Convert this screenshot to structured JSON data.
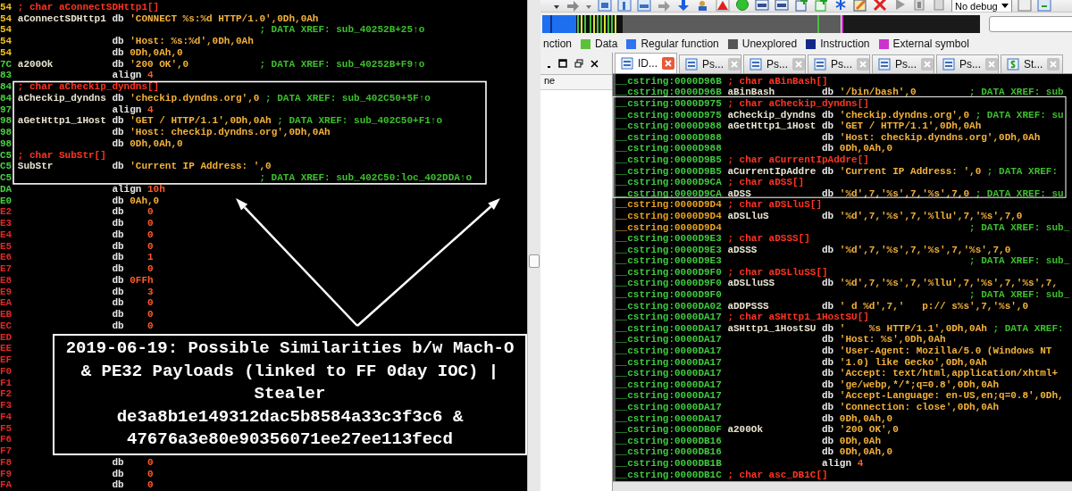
{
  "left_listing": {
    "rows": [
      {
        "addr": "54",
        "color": "#f0c020",
        "kind": "decl",
        "text": "; char aConnectSDHttp1[]"
      },
      {
        "addr": "54",
        "color": "#f0c020",
        "kind": "code",
        "label": "aConnectSDHttp1",
        "mnemonic": "db",
        "operand": "'CONNECT %s:%d HTTP/1.0',0Dh,0Ah"
      },
      {
        "addr": "54",
        "color": "#f0c020",
        "kind": "code",
        "comment": "; DATA XREF: sub_40252B+25↑o"
      },
      {
        "addr": "54",
        "color": "#f0c020",
        "kind": "code",
        "mnemonic": "db",
        "operand": "'Host: %s:%d',0Dh,0Ah"
      },
      {
        "addr": "54",
        "color": "#f0c020",
        "kind": "code",
        "mnemonic": "db",
        "operand": "0Dh,0Ah,0"
      },
      {
        "addr": "7C",
        "color": "#48d040",
        "kind": "code",
        "label": "a200Ok",
        "mnemonic": "db",
        "operand": "'200 OK',0",
        "comment": "; DATA XREF: sub_40252B+F9↑o"
      },
      {
        "addr": "83",
        "color": "#48d040",
        "kind": "align",
        "mnemonic": "align",
        "operand": "4"
      },
      {
        "addr": "84",
        "color": "#48d040",
        "kind": "decl",
        "text": "; char aCheckip_dyndns[]"
      },
      {
        "addr": "84",
        "color": "#48d040",
        "kind": "code",
        "label": "aCheckip_dyndns",
        "mnemonic": "db",
        "operand": "'checkip.dyndns.org',0",
        "comment": "; DATA XREF: sub_402C50+5F↑o"
      },
      {
        "addr": "97",
        "color": "#48d040",
        "kind": "align",
        "mnemonic": "align",
        "operand": "4"
      },
      {
        "addr": "98",
        "color": "#48d040",
        "kind": "code",
        "label": "aGetHttp1_1Host",
        "mnemonic": "db",
        "operand": "'GET / HTTP/1.1',0Dh,0Ah",
        "comment": "; DATA XREF: sub_402C50+F1↑o"
      },
      {
        "addr": "98",
        "color": "#48d040",
        "kind": "code",
        "mnemonic": "db",
        "operand": "'Host: checkip.dyndns.org',0Dh,0Ah"
      },
      {
        "addr": "98",
        "color": "#48d040",
        "kind": "code",
        "mnemonic": "db",
        "operand": "0Dh,0Ah,0"
      },
      {
        "addr": "C5",
        "color": "#48d040",
        "kind": "decl",
        "text": "; char SubStr[]"
      },
      {
        "addr": "C5",
        "color": "#48d040",
        "kind": "code",
        "label": "SubStr",
        "mnemonic": "db",
        "operand": "'Current IP Address: ',0"
      },
      {
        "addr": "C5",
        "color": "#48d040",
        "kind": "code",
        "comment": "; DATA XREF: sub_402C50:loc_402DDA↑o"
      },
      {
        "addr": "DA",
        "color": "#48d040",
        "kind": "align",
        "mnemonic": "align",
        "operand": "10h"
      },
      {
        "addr": "E0",
        "color": "#48d040",
        "kind": "code",
        "mnemonic": "db",
        "operand": "0Ah,0"
      },
      {
        "addr": "E2",
        "color": "#e02828",
        "kind": "byte",
        "mnemonic": "db",
        "operand": "0"
      },
      {
        "addr": "E3",
        "color": "#e02828",
        "kind": "byte",
        "mnemonic": "db",
        "operand": "0"
      },
      {
        "addr": "E4",
        "color": "#e02828",
        "kind": "byte",
        "mnemonic": "db",
        "operand": "0"
      },
      {
        "addr": "E5",
        "color": "#e02828",
        "kind": "byte",
        "mnemonic": "db",
        "operand": "0"
      },
      {
        "addr": "E6",
        "color": "#e02828",
        "kind": "byte",
        "mnemonic": "db",
        "operand": "1"
      },
      {
        "addr": "E7",
        "color": "#e02828",
        "kind": "byte",
        "mnemonic": "db",
        "operand": "0"
      },
      {
        "addr": "E8",
        "color": "#e02828",
        "kind": "byte",
        "mnemonic": "db",
        "operand": "0FFh"
      },
      {
        "addr": "E9",
        "color": "#e02828",
        "kind": "byte",
        "mnemonic": "db",
        "operand": "3"
      },
      {
        "addr": "EA",
        "color": "#e02828",
        "kind": "byte",
        "mnemonic": "db",
        "operand": "0"
      },
      {
        "addr": "EB",
        "color": "#e02828",
        "kind": "byte",
        "mnemonic": "db",
        "operand": "0"
      },
      {
        "addr": "EC",
        "color": "#e02828",
        "kind": "byte",
        "mnemonic": "db",
        "operand": "0"
      },
      {
        "addr": "ED",
        "color": "#e02828",
        "kind": "code"
      },
      {
        "addr": "EE",
        "color": "#e02828",
        "kind": "code"
      },
      {
        "addr": "EF",
        "color": "#e02828",
        "kind": "code"
      },
      {
        "addr": "F0",
        "color": "#e02828",
        "kind": "code"
      },
      {
        "addr": "F1",
        "color": "#e02828",
        "kind": "code"
      },
      {
        "addr": "F2",
        "color": "#e02828",
        "kind": "code"
      },
      {
        "addr": "F3",
        "color": "#e02828",
        "kind": "code"
      },
      {
        "addr": "F4",
        "color": "#e02828",
        "kind": "code"
      },
      {
        "addr": "F5",
        "color": "#e02828",
        "kind": "code"
      },
      {
        "addr": "F6",
        "color": "#e02828",
        "kind": "code"
      },
      {
        "addr": "F7",
        "color": "#e02828",
        "kind": "code"
      },
      {
        "addr": "F8",
        "color": "#e02828",
        "kind": "byte",
        "mnemonic": "db",
        "operand": "0"
      },
      {
        "addr": "F9",
        "color": "#e02828",
        "kind": "byte",
        "mnemonic": "db",
        "operand": "0"
      },
      {
        "addr": "FA",
        "color": "#e02828",
        "kind": "byte",
        "mnemonic": "db",
        "operand": "0"
      }
    ]
  },
  "ida_window": {
    "toolbar": {
      "debugger_select": "No debug"
    },
    "legend": [
      {
        "label": "nction"
      },
      {
        "label": "Data",
        "color": "#5cc23e"
      },
      {
        "label": "Regular function",
        "color": "#2f74f0"
      },
      {
        "label": "Unexplored",
        "color": "#555555"
      },
      {
        "label": "Instruction",
        "color": "#13288a"
      },
      {
        "label": "External symbol",
        "color": "#cc33cc"
      }
    ],
    "functions_pane": {
      "column_header": "ne"
    },
    "tabs": [
      {
        "label": "ID...",
        "kind": "listing",
        "selected": true
      },
      {
        "label": "Ps...",
        "kind": "listing",
        "selected": false
      },
      {
        "label": "Ps...",
        "kind": "listing",
        "selected": false
      },
      {
        "label": "Ps...",
        "kind": "listing",
        "selected": false
      },
      {
        "label": "Ps...",
        "kind": "listing",
        "selected": false
      },
      {
        "label": "Ps...",
        "kind": "listing",
        "selected": false
      },
      {
        "label": "St...",
        "kind": "strings",
        "selected": false
      }
    ],
    "listing": {
      "rows": [
        {
          "addr": "__cstring:0000D96B",
          "color": "#40c840",
          "kind": "decl",
          "text": "; char aBinBash[]"
        },
        {
          "addr": "__cstring:0000D96B",
          "color": "#40c840",
          "kind": "code",
          "label": "aBinBash",
          "mnemonic": "db",
          "operand": "'/bin/bash',0",
          "comment": "; DATA XREF: sub"
        },
        {
          "addr": "__cstring:0000D975",
          "color": "#40c840",
          "kind": "decl",
          "text": "; char aCheckip_dyndns[]"
        },
        {
          "addr": "__cstring:0000D975",
          "color": "#40c840",
          "kind": "code",
          "label": "aCheckip_dyndns",
          "mnemonic": "db",
          "operand": "'checkip.dyndns.org',0",
          "comment": "; DATA XREF: su"
        },
        {
          "addr": "__cstring:0000D988",
          "color": "#40c840",
          "kind": "code",
          "label": "aGetHttp1_1Host",
          "mnemonic": "db",
          "operand": "'GET / HTTP/1.1',0Dh,0Ah"
        },
        {
          "addr": "__cstring:0000D988",
          "color": "#40c840",
          "kind": "code",
          "mnemonic": "db",
          "operand": "'Host: checkip.dyndns.org',0Dh,0Ah"
        },
        {
          "addr": "__cstring:0000D988",
          "color": "#40c840",
          "kind": "code",
          "mnemonic": "db",
          "operand": "0Dh,0Ah,0"
        },
        {
          "addr": "__cstring:0000D9B5",
          "color": "#40c840",
          "kind": "decl",
          "text": "; char aCurrentIpAddre[]"
        },
        {
          "addr": "__cstring:0000D9B5",
          "color": "#40c840",
          "kind": "code",
          "label": "aCurrentIpAddre",
          "mnemonic": "db",
          "operand": "'Current IP Address: ',0",
          "comment": "; DATA XREF:"
        },
        {
          "addr": "__cstring:0000D9CA",
          "color": "#40c840",
          "kind": "decl",
          "text": "; char aDSS[]"
        },
        {
          "addr": "__cstring:0000D9CA",
          "color": "#40c840",
          "kind": "code",
          "label": "aDSS",
          "mnemonic": "db",
          "operand": "'%d',7,'%s',7,'%s',7,0",
          "comment": "; DATA XREF: su"
        },
        {
          "addr": "__cstring:0000D9D4",
          "color": "#e8a020",
          "kind": "decl",
          "text": "; char aDSLluS[]"
        },
        {
          "addr": "__cstring:0000D9D4",
          "color": "#e8a020",
          "kind": "code",
          "label": "aDSLluS",
          "mnemonic": "db",
          "operand": "'%d',7,'%s',7,'%llu',7,'%s',7,0"
        },
        {
          "addr": "__cstring:0000D9D4",
          "color": "#e8a020",
          "kind": "code",
          "comment": "; DATA XREF: sub_"
        },
        {
          "addr": "__cstring:0000D9E3",
          "color": "#40c840",
          "kind": "decl",
          "text": "; char aDSSS[]"
        },
        {
          "addr": "__cstring:0000D9E3",
          "color": "#40c840",
          "kind": "code",
          "label": "aDSSS",
          "mnemonic": "db",
          "operand": "'%d',7,'%s',7,'%s',7,'%s',7,0"
        },
        {
          "addr": "__cstring:0000D9E3",
          "color": "#40c840",
          "kind": "code",
          "comment": "; DATA XREF: sub_"
        },
        {
          "addr": "__cstring:0000D9F0",
          "color": "#40c840",
          "kind": "decl",
          "text": "; char aDSLluSS[]"
        },
        {
          "addr": "__cstring:0000D9F0",
          "color": "#40c840",
          "kind": "code",
          "label": "aDSLluSS",
          "mnemonic": "db",
          "operand": "'%d',7,'%s',7,'%llu',7,'%s',7,'%s',7,"
        },
        {
          "addr": "__cstring:0000D9F0",
          "color": "#40c840",
          "kind": "code",
          "comment": "; DATA XREF: sub_"
        },
        {
          "addr": "__cstring:0000DA02",
          "color": "#40c840",
          "kind": "code",
          "label": "aDDPSSS",
          "mnemonic": "db",
          "operand": "' d %d',7,'   p:// s%s',7,'%s',0"
        },
        {
          "addr": "__cstring:0000DA17",
          "color": "#40c840",
          "kind": "decl",
          "text": "; char aSHttp1_1HostSU[]"
        },
        {
          "addr": "__cstring:0000DA17",
          "color": "#40c840",
          "kind": "code",
          "label": "aSHttp1_1HostSU",
          "mnemonic": "db",
          "operand": "'    %s HTTP/1.1',0Dh,0Ah",
          "comment": "; DATA XREF:"
        },
        {
          "addr": "__cstring:0000DA17",
          "color": "#40c840",
          "kind": "code",
          "mnemonic": "db",
          "operand": "'Host: %s',0Dh,0Ah"
        },
        {
          "addr": "__cstring:0000DA17",
          "color": "#40c840",
          "kind": "code",
          "mnemonic": "db",
          "operand": "'User-Agent: Mozilla/5.0 (Windows NT"
        },
        {
          "addr": "__cstring:0000DA17",
          "color": "#40c840",
          "kind": "code",
          "mnemonic": "db",
          "operand": "'1.0) like Gecko',0Dh,0Ah"
        },
        {
          "addr": "__cstring:0000DA17",
          "color": "#40c840",
          "kind": "code",
          "mnemonic": "db",
          "operand": "'Accept: text/html,application/xhtml+"
        },
        {
          "addr": "__cstring:0000DA17",
          "color": "#40c840",
          "kind": "code",
          "mnemonic": "db",
          "operand": "'ge/webp,*/*;q=0.8',0Dh,0Ah"
        },
        {
          "addr": "__cstring:0000DA17",
          "color": "#40c840",
          "kind": "code",
          "mnemonic": "db",
          "operand": "'Accept-Language: en-US,en;q=0.8',0Dh,"
        },
        {
          "addr": "__cstring:0000DA17",
          "color": "#40c840",
          "kind": "code",
          "mnemonic": "db",
          "operand": "'Connection: close',0Dh,0Ah"
        },
        {
          "addr": "__cstring:0000DA17",
          "color": "#40c840",
          "kind": "code",
          "mnemonic": "db",
          "operand": "0Dh,0Ah,0"
        },
        {
          "addr": "__cstring:0000DB0F",
          "color": "#40c840",
          "kind": "code",
          "label": "a200Ok",
          "mnemonic": "db",
          "operand": "'200 OK',0"
        },
        {
          "addr": "__cstring:0000DB16",
          "color": "#40c840",
          "kind": "code",
          "mnemonic": "db",
          "operand": "0Dh,0Ah"
        },
        {
          "addr": "__cstring:0000DB16",
          "color": "#40c840",
          "kind": "code",
          "mnemonic": "db",
          "operand": "0Dh,0Ah,0"
        },
        {
          "addr": "__cstring:0000DB1B",
          "color": "#40c840",
          "kind": "align",
          "mnemonic": "align",
          "operand": "4"
        },
        {
          "addr": "__cstring:0000DB1C",
          "color": "#40c840",
          "kind": "decl",
          "text": "; char asc_DB1C[]"
        }
      ]
    }
  },
  "caption": {
    "title": "2019-06-19: Possible Similarities b/w Mach-O & PE32 Payloads (linked to FF 0day IOC) | Stealer",
    "hashes": "de3a8b1e149312dac5b8584a33c3f3c6 & 47676a3e80e90356071ee27ee113fecd"
  }
}
